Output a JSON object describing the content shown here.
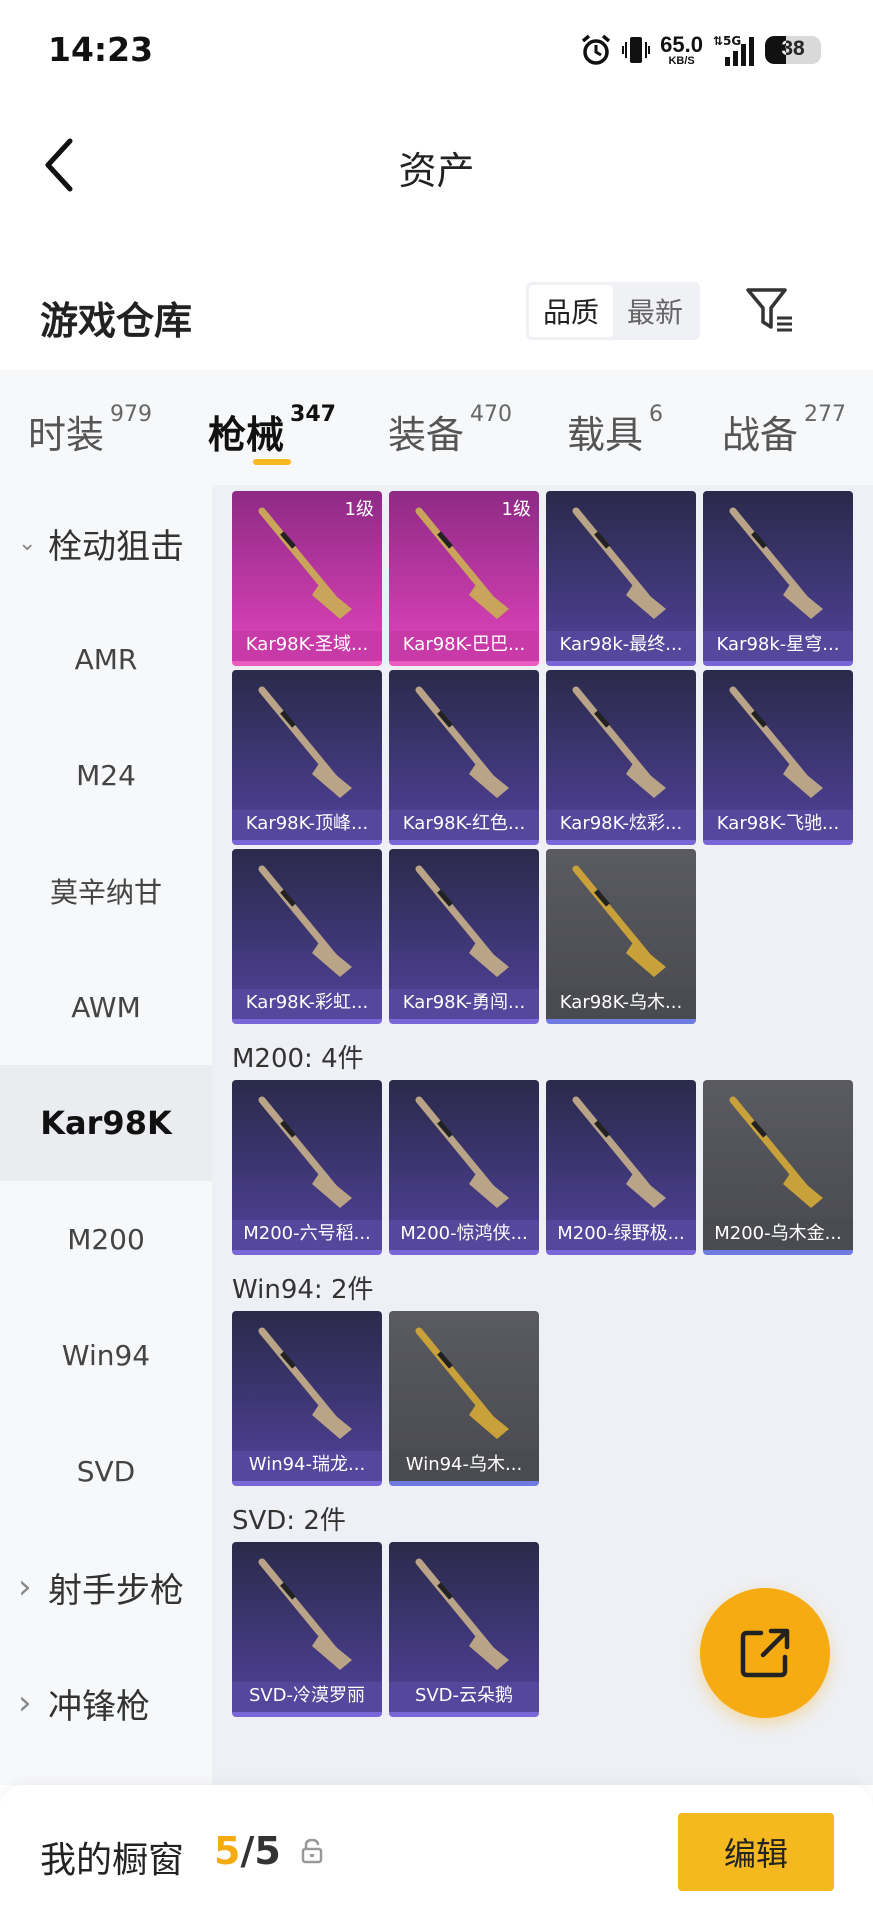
{
  "status_bar": {
    "time": "14:23",
    "net_speed": "65.0",
    "net_unit": "KB/S",
    "network": "5G",
    "battery": "38"
  },
  "header": {
    "title": "资产",
    "back_icon": "chevron-left-icon"
  },
  "warehouse": {
    "title": "游戏仓库",
    "sort_options": [
      "品质",
      "最新"
    ],
    "active_sort": "品质",
    "filter_icon": "filter-icon"
  },
  "tabs": [
    {
      "label": "时装",
      "count": "979"
    },
    {
      "label": "枪械",
      "count": "347",
      "active": true
    },
    {
      "label": "装备",
      "count": "470"
    },
    {
      "label": "载具",
      "count": "6"
    },
    {
      "label": "战备",
      "count": "277"
    }
  ],
  "sidebar": {
    "items": [
      {
        "label": "栓动狙击",
        "type": "category",
        "expanded": true
      },
      {
        "label": "AMR"
      },
      {
        "label": "M24"
      },
      {
        "label": "莫辛纳甘"
      },
      {
        "label": "AWM"
      },
      {
        "label": "Kar98K",
        "active": true
      },
      {
        "label": "M200"
      },
      {
        "label": "Win94"
      },
      {
        "label": "SVD"
      },
      {
        "label": "射手步枪",
        "type": "category"
      },
      {
        "label": "冲锋枪",
        "type": "category"
      }
    ]
  },
  "groups": [
    {
      "title": "",
      "items": [
        {
          "name": "Kar98K-圣域...",
          "rarity": "pink",
          "level": "1级"
        },
        {
          "name": "Kar98K-巴巴...",
          "rarity": "pink",
          "level": "1级"
        },
        {
          "name": "Kar98k-最终...",
          "rarity": "purple"
        },
        {
          "name": "Kar98k-星穹...",
          "rarity": "purple"
        },
        {
          "name": "Kar98K-顶峰...",
          "rarity": "purple"
        },
        {
          "name": "Kar98K-红色...",
          "rarity": "purple"
        },
        {
          "name": "Kar98K-炫彩...",
          "rarity": "purple"
        },
        {
          "name": "Kar98K-飞驰...",
          "rarity": "purple"
        },
        {
          "name": "Kar98K-彩虹...",
          "rarity": "purple"
        },
        {
          "name": "Kar98K-勇闯...",
          "rarity": "purple"
        },
        {
          "name": "Kar98K-乌木...",
          "rarity": "gray"
        }
      ]
    },
    {
      "title": "M200: 4件",
      "items": [
        {
          "name": "M200-六号稻...",
          "rarity": "purple"
        },
        {
          "name": "M200-惊鸿侠...",
          "rarity": "purple"
        },
        {
          "name": "M200-绿野极...",
          "rarity": "purple"
        },
        {
          "name": "M200-乌木金...",
          "rarity": "gray"
        }
      ]
    },
    {
      "title": "Win94: 2件",
      "items": [
        {
          "name": "Win94-瑞龙...",
          "rarity": "purple"
        },
        {
          "name": "Win94-乌木...",
          "rarity": "gray"
        }
      ]
    },
    {
      "title": "SVD: 2件",
      "items": [
        {
          "name": "SVD-冷漠罗丽",
          "rarity": "purple"
        },
        {
          "name": "SVD-云朵鹅",
          "rarity": "purple"
        }
      ]
    }
  ],
  "fab": {
    "icon": "share-icon"
  },
  "bottom_bar": {
    "title": "我的橱窗",
    "current": "5",
    "separator": "/",
    "max": "5",
    "lock_icon": "lock-icon",
    "edit_label": "编辑"
  },
  "colors": {
    "accent": "#f5b81f",
    "pink_card": "#c03ca0",
    "purple_card": "#3a3568",
    "gray_card": "#55565c"
  }
}
